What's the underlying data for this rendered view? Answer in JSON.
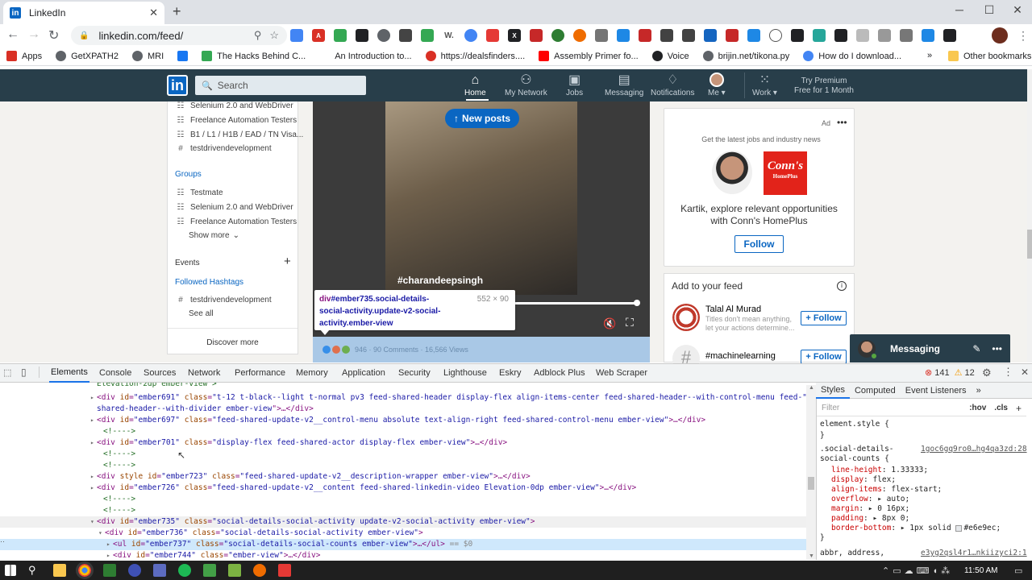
{
  "browser": {
    "tab_title": "LinkedIn",
    "url": "linkedin.com/feed/",
    "bookmarks": [
      {
        "label": "Apps",
        "color": "#d93025"
      },
      {
        "label": "GetXPATH2",
        "color": "#5f6368"
      },
      {
        "label": "MRI",
        "color": "#5f6368"
      },
      {
        "label": "",
        "color": "#1877f2"
      },
      {
        "label": "The Hacks Behind C...",
        "color": "#34a853"
      },
      {
        "label": "An Introduction to...",
        "color": "#ffffff"
      },
      {
        "label": "https://dealsfinders....",
        "color": "#d93025"
      },
      {
        "label": "Assembly Primer fo...",
        "color": "#ff0000"
      },
      {
        "label": "Voice",
        "color": "#202124"
      },
      {
        "label": "brijin.net/tikona.py",
        "color": "#5f6368"
      },
      {
        "label": "How do I download...",
        "color": "#4285f4"
      }
    ],
    "more_bookmarks": "»",
    "other_bookmarks": "Other bookmarks"
  },
  "linkedin": {
    "logo": "in",
    "search_placeholder": "Search",
    "nav": [
      {
        "label": "Home",
        "icon": "home-icon",
        "glyph": "⌂"
      },
      {
        "label": "My Network",
        "icon": "network-icon",
        "glyph": "👥"
      },
      {
        "label": "Jobs",
        "icon": "briefcase-icon",
        "glyph": "💼"
      },
      {
        "label": "Messaging",
        "icon": "messaging-icon",
        "glyph": "💬"
      },
      {
        "label": "Notifications",
        "icon": "bell-icon",
        "glyph": "🔔"
      },
      {
        "label": "Me ▾",
        "icon": "avatar-icon",
        "glyph": "●"
      },
      {
        "label": "Work ▾",
        "icon": "grid-icon",
        "glyph": "⋮⋮"
      }
    ],
    "premium": "Try Premium Free for 1 Month",
    "left_panel": {
      "items_top": [
        "Selenium 2.0 and WebDriver",
        "Freelance Automation Testers",
        "B1 / L1 / H1B / EAD / TN Visa...",
        "testdrivendevelopment"
      ],
      "groups_heading": "Groups",
      "groups": [
        "Testmate",
        "Selenium 2.0 and WebDriver",
        "Freelance Automation Testers"
      ],
      "show_more": "Show more",
      "events": "Events",
      "followed_hashtags": "Followed Hashtags",
      "hashtag": "testdrivendevelopment",
      "see_all": "See all",
      "discover_more": "Discover more"
    },
    "video": {
      "new_posts": "New posts",
      "hashtag": "#charandeepsingh",
      "social_counts": "946 · 90 Comments · 16,566 Views"
    },
    "inspect_tooltip": {
      "tag": "div",
      "selector": "#ember735.social-details-social-activity.update-v2-social-activity.ember-view",
      "dims": "552 × 90"
    },
    "ad": {
      "label": "Ad",
      "tagline": "Get the latest jobs and industry news",
      "brand": "Conn's",
      "brand_sub": "HomePlus",
      "message": "Kartik, explore relevant opportunities with Conn's HomePlus",
      "follow": "Follow"
    },
    "feed": {
      "title": "Add to your feed",
      "items": [
        {
          "name": "Talal Al Murad",
          "desc": "Titles don't mean anything, let your actions determine...",
          "follow": "+ Follow"
        },
        {
          "name": "#machinelearning",
          "desc": "",
          "follow": "+ Follow"
        }
      ]
    },
    "messaging": "Messaging"
  },
  "devtools": {
    "tabs": [
      "Elements",
      "Console",
      "Sources",
      "Network",
      "Performance",
      "Memory",
      "Application",
      "Security",
      "Lighthouse",
      "Eskry",
      "Adblock Plus",
      "Web Scraper"
    ],
    "errors": "141",
    "warnings": "12",
    "dom_lines": [
      {
        "indent": 120,
        "arrow": "",
        "html": "<span class='cm'>Elevation-2dp ember-view\"></span>"
      },
      {
        "indent": 120,
        "arrow": "▸",
        "tag": "div",
        "id": "ember691",
        "cls": "t-12 t-black--light t-normal pv3 feed-shared-header display-flex align-items-center feed-shared-header--with-control-menu feed-"
      },
      {
        "indent": 120,
        "arrow": "",
        "cont": "shared-header--with-divider ember-view\">…</div>"
      },
      {
        "indent": 120,
        "arrow": "▸",
        "tag": "div",
        "id": "ember697",
        "cls": "feed-shared-update-v2__control-menu absolute text-align-right feed-shared-control-menu ember-view",
        "tail": ">…</div>"
      },
      {
        "indent": 128,
        "arrow": "",
        "comment": "<!---->"
      },
      {
        "indent": 120,
        "arrow": "▸",
        "tag": "div",
        "id": "ember701",
        "cls": "display-flex feed-shared-actor display-flex ember-view",
        "tail": ">…</div>"
      },
      {
        "indent": 128,
        "arrow": "",
        "comment": "<!---->"
      },
      {
        "indent": 128,
        "arrow": "",
        "comment": "<!---->"
      },
      {
        "indent": 120,
        "arrow": "▸",
        "tag": "div",
        "style": true,
        "id": "ember723",
        "cls": "feed-shared-update-v2__description-wrapper ember-view",
        "tail": ">…</div>"
      },
      {
        "indent": 120,
        "arrow": "▸",
        "tag": "div",
        "id": "ember726",
        "cls": "feed-shared-update-v2__content feed-shared-linkedin-video Elevation-0dp ember-view",
        "tail": ">…</div>"
      },
      {
        "indent": 128,
        "arrow": "",
        "comment": "<!---->"
      },
      {
        "indent": 128,
        "arrow": "",
        "comment": "<!---->"
      },
      {
        "indent": 120,
        "arrow": "▾",
        "tag": "div",
        "id": "ember735",
        "cls": "social-details-social-activity update-v2-social-activity ember-view",
        "tail": ">",
        "hl": "hl2"
      },
      {
        "indent": 130,
        "arrow": "▾",
        "tag": "div",
        "id": "ember736",
        "cls": "social-details-social-activity ember-view",
        "tail": ">"
      },
      {
        "indent": 140,
        "arrow": "▸",
        "tag": "ul",
        "id": "ember737",
        "cls": "social-details-social-counts ember-view",
        "tail": ">…</ul> == $0",
        "hl": "hl"
      },
      {
        "indent": 140,
        "arrow": "▸",
        "tag": "div",
        "id": "ember744",
        "cls": "ember-view",
        "tail": ">…</div>"
      }
    ],
    "styles_tabs": [
      "Styles",
      "Computed",
      "Event Listeners",
      "»"
    ],
    "filter": "Filter",
    "hov": ":hov",
    "cls": ".cls",
    "style_rules": [
      {
        "sel": "element.style {"
      },
      {
        "sel": "}"
      },
      {
        "sel": ".social-details-",
        "src": "1goc6gq9ro0…hg4qa3zd:28"
      },
      {
        "sel": "social-counts {"
      },
      {
        "prop": "line-height",
        "val": "1.33333;"
      },
      {
        "prop": "display",
        "val": "flex;"
      },
      {
        "prop": "align-items",
        "val": "flex-start;"
      },
      {
        "prop": "overflow",
        "val": "▸ auto;"
      },
      {
        "prop": "margin",
        "val": "▸ 0 16px;"
      },
      {
        "prop": "padding",
        "val": "▸ 8px 0;"
      },
      {
        "prop": "border-bottom",
        "val": "▸ 1px solid #e6e9ec;"
      },
      {
        "sel": "}"
      },
      {
        "sel": "abbr, address,",
        "src": "e3yg2qsl4r1…nkiizyci2:1"
      }
    ]
  },
  "taskbar": {
    "time": "11:50 AM"
  }
}
